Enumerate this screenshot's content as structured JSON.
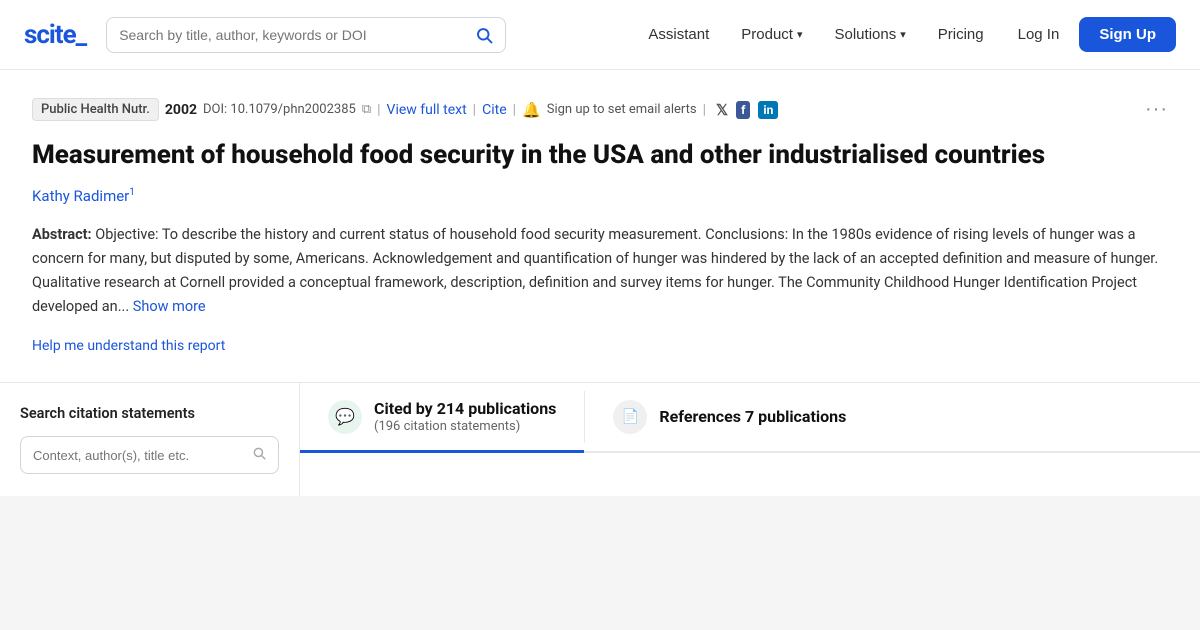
{
  "header": {
    "logo": "scite_",
    "search": {
      "placeholder": "Search by title, author, keywords or DOI"
    },
    "nav": [
      {
        "label": "Assistant",
        "hasDropdown": false
      },
      {
        "label": "Product",
        "hasDropdown": true
      },
      {
        "label": "Solutions",
        "hasDropdown": true
      },
      {
        "label": "Pricing",
        "hasDropdown": false
      }
    ],
    "login_label": "Log In",
    "signup_label": "Sign Up"
  },
  "paper": {
    "journal": "Public Health Nutr.",
    "year": "2002",
    "doi_label": "DOI: 10.1079/phn2002385",
    "view_full_text": "View full text",
    "cite": "Cite",
    "email_alert": "Sign up to set email alerts",
    "title": "Measurement of household food security in the USA and other industrialised countries",
    "authors": [
      {
        "name": "Kathy Radimer",
        "sup": "1"
      }
    ],
    "abstract_label": "Abstract:",
    "abstract_text": "Objective: To describe the history and current status of household food security measurement. Conclusions: In the 1980s evidence of rising levels of hunger was a concern for many, but disputed by some, Americans. Acknowledgement and quantification of hunger was hindered by the lack of an accepted definition and measure of hunger. Qualitative research at Cornell provided a conceptual framework, description, definition and survey items for hunger. The Community Childhood Hunger Identification Project developed an...",
    "show_more": "Show more",
    "help_link": "Help me understand this report"
  },
  "bottom": {
    "search_panel": {
      "title": "Search citation statements",
      "input_placeholder": "Context, author(s), title etc."
    },
    "tabs": [
      {
        "id": "cited-by",
        "icon": "💬",
        "icon_bg": "green",
        "main_label": "Cited by 214 publications",
        "sub_label": "(196 citation statements)",
        "active": true
      },
      {
        "id": "references",
        "icon": "📄",
        "icon_bg": "grey",
        "main_label": "References 7 publications",
        "sub_label": "",
        "active": false
      }
    ]
  },
  "icons": {
    "search": "🔍",
    "bell": "🔔",
    "twitter": "𝕏",
    "facebook": "f",
    "linkedin": "in",
    "more": "···",
    "copy": "⧉"
  },
  "colors": {
    "accent": "#1a56db",
    "green": "#2d9e5f",
    "green_bg": "#e8f4ee"
  }
}
